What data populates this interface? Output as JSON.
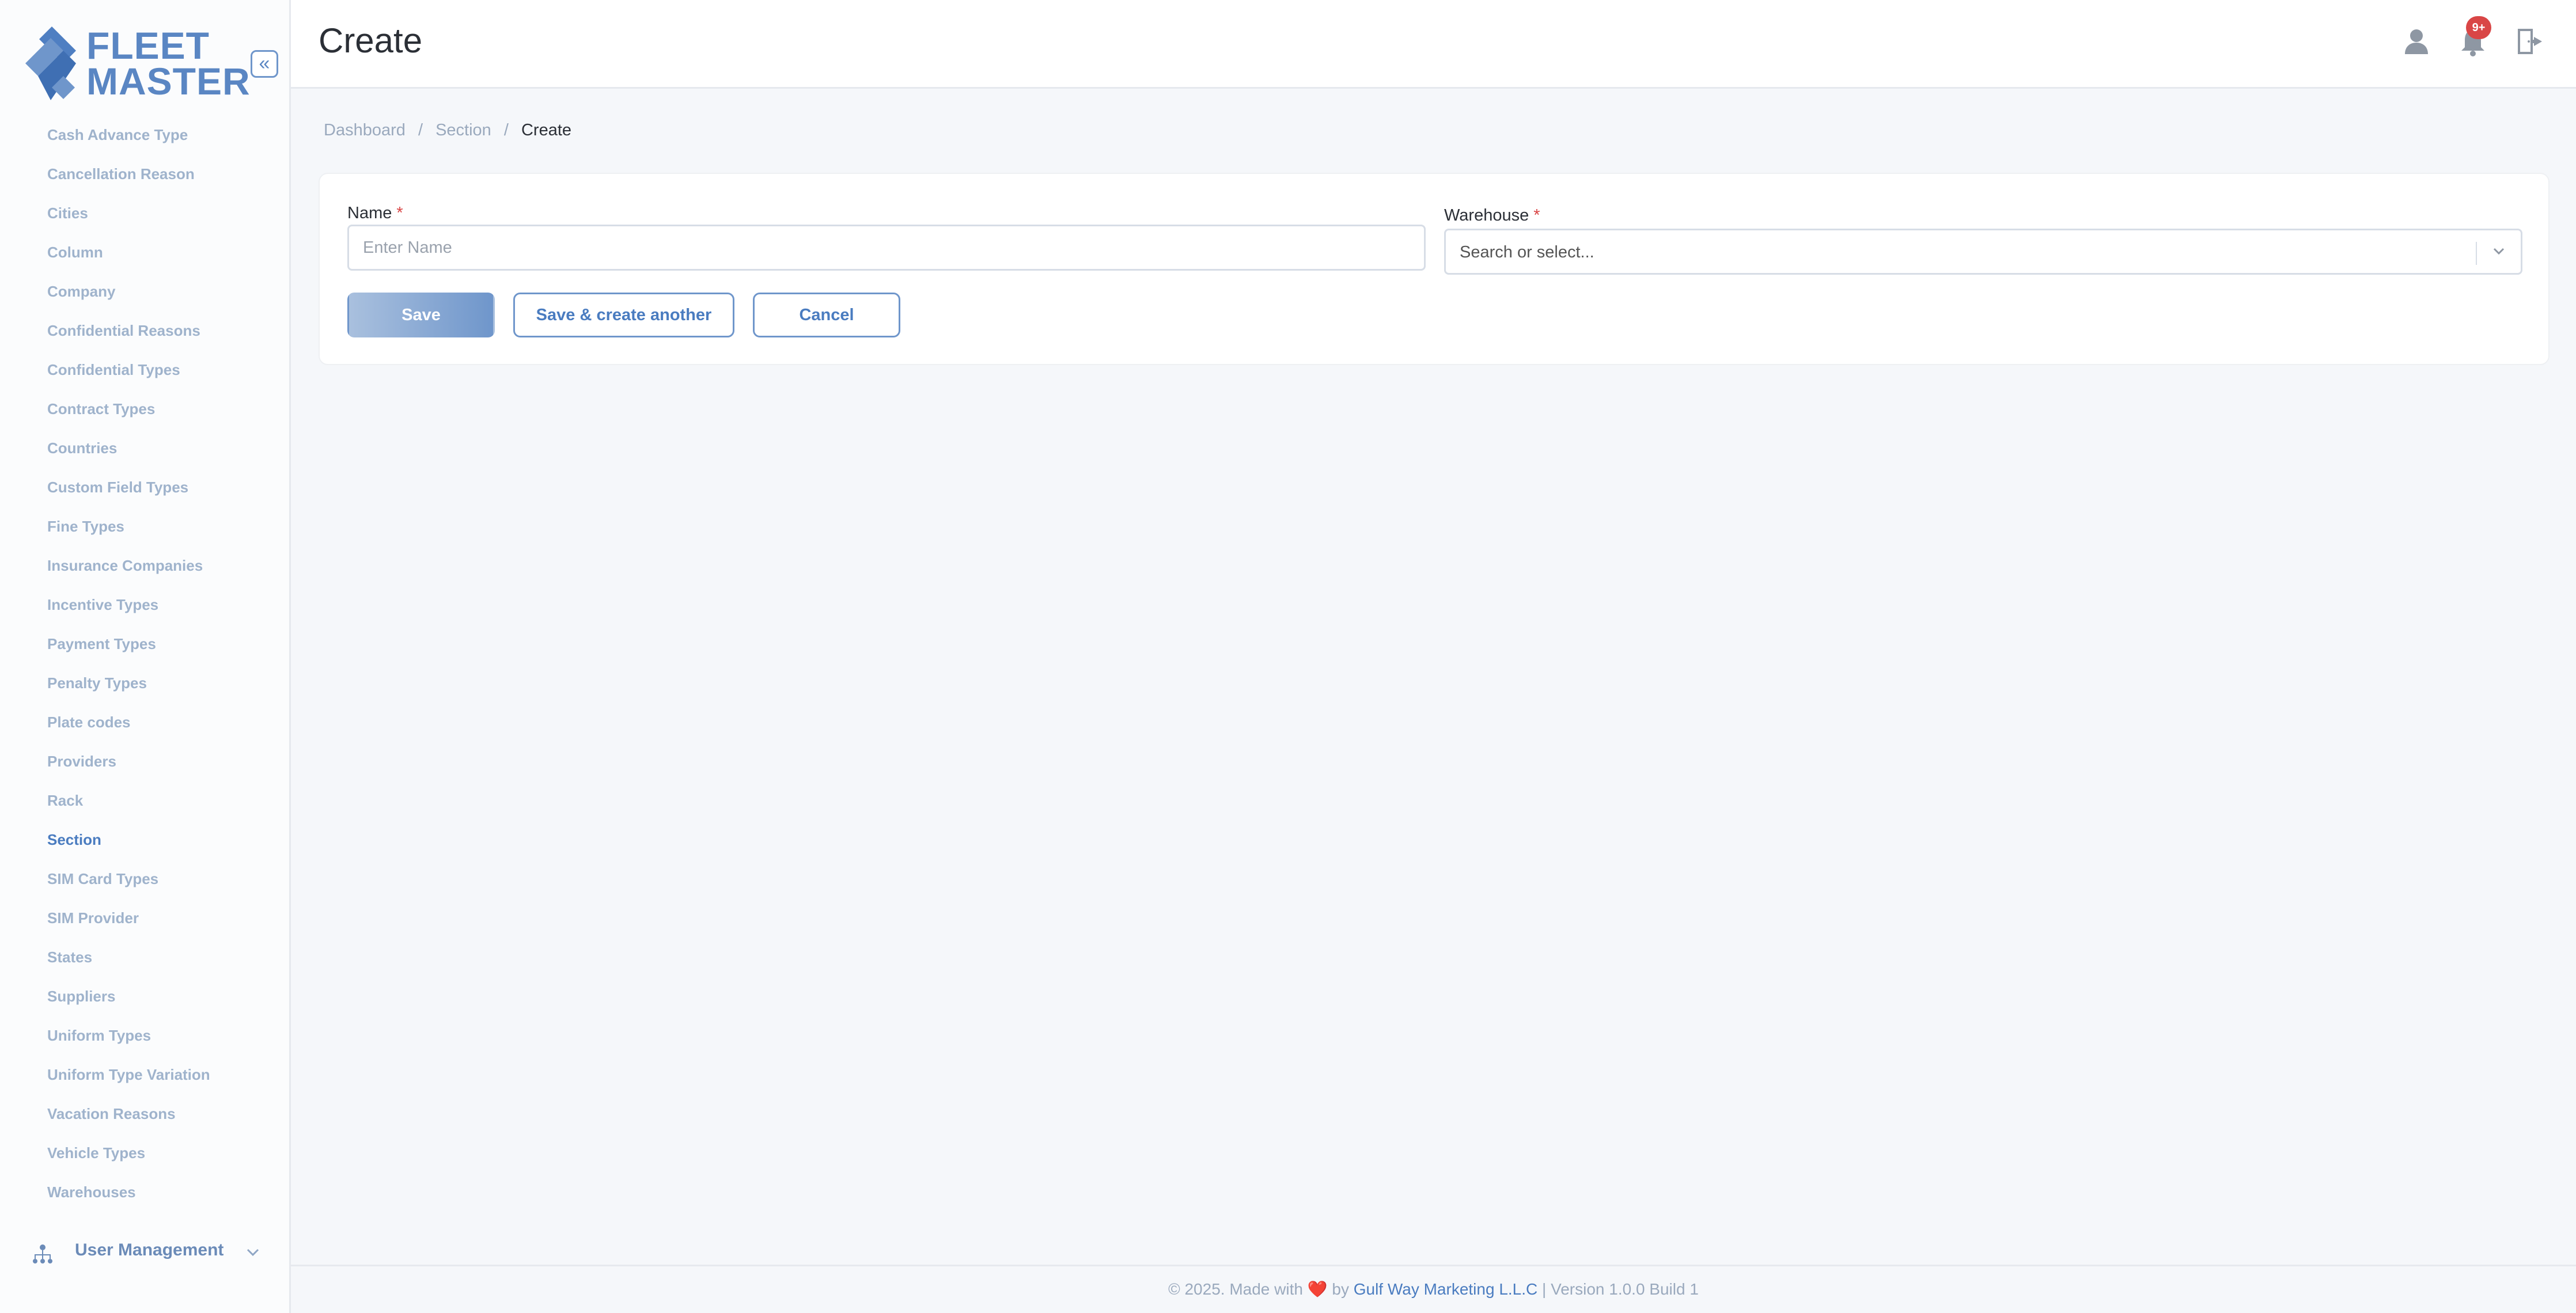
{
  "app": {
    "logo_line1": "FLEET",
    "logo_line2": "MASTER",
    "collapse_glyph": "«"
  },
  "sidebar": {
    "items": [
      {
        "label": "Cash Advance Type",
        "active": false
      },
      {
        "label": "Cancellation Reason",
        "active": false
      },
      {
        "label": "Cities",
        "active": false
      },
      {
        "label": "Column",
        "active": false
      },
      {
        "label": "Company",
        "active": false
      },
      {
        "label": "Confidential Reasons",
        "active": false
      },
      {
        "label": "Confidential Types",
        "active": false
      },
      {
        "label": "Contract Types",
        "active": false
      },
      {
        "label": "Countries",
        "active": false
      },
      {
        "label": "Custom Field Types",
        "active": false
      },
      {
        "label": "Fine Types",
        "active": false
      },
      {
        "label": "Insurance Companies",
        "active": false
      },
      {
        "label": "Incentive Types",
        "active": false
      },
      {
        "label": "Payment Types",
        "active": false
      },
      {
        "label": "Penalty Types",
        "active": false
      },
      {
        "label": "Plate codes",
        "active": false
      },
      {
        "label": "Providers",
        "active": false
      },
      {
        "label": "Rack",
        "active": false
      },
      {
        "label": "Section",
        "active": true
      },
      {
        "label": "SIM Card Types",
        "active": false
      },
      {
        "label": "SIM Provider",
        "active": false
      },
      {
        "label": "States",
        "active": false
      },
      {
        "label": "Suppliers",
        "active": false
      },
      {
        "label": "Uniform Types",
        "active": false
      },
      {
        "label": "Uniform Type Variation",
        "active": false
      },
      {
        "label": "Vacation Reasons",
        "active": false
      },
      {
        "label": "Vehicle Types",
        "active": false
      },
      {
        "label": "Warehouses",
        "active": false
      }
    ],
    "group": {
      "label": "User Management",
      "icon": "sitemap-icon",
      "chevron": "chevron-down-icon"
    }
  },
  "header": {
    "title": "Create",
    "notification_count": "9+",
    "icons": [
      "user-icon",
      "bell-icon",
      "logout-icon"
    ]
  },
  "breadcrumb": {
    "items": [
      "Dashboard",
      "Section"
    ],
    "current": "Create",
    "separator": "/"
  },
  "form": {
    "name_label": "Name",
    "name_value": "",
    "name_placeholder": "Enter Name",
    "warehouse_label": "Warehouse",
    "warehouse_placeholder": "Search or select...",
    "required_mark": "*",
    "save_label": "Save",
    "save_another_label": "Save & create another",
    "cancel_label": "Cancel"
  },
  "footer": {
    "prefix": "© 2025. Made with",
    "heart": "❤️",
    "by": "by",
    "company": "Gulf Way Marketing L.L.C",
    "version": "| Version 1.0.0 Build 1"
  },
  "colors": {
    "accent": "#5a86c3",
    "badge": "#d94646",
    "sidebar_text": "#9fb3cc"
  }
}
